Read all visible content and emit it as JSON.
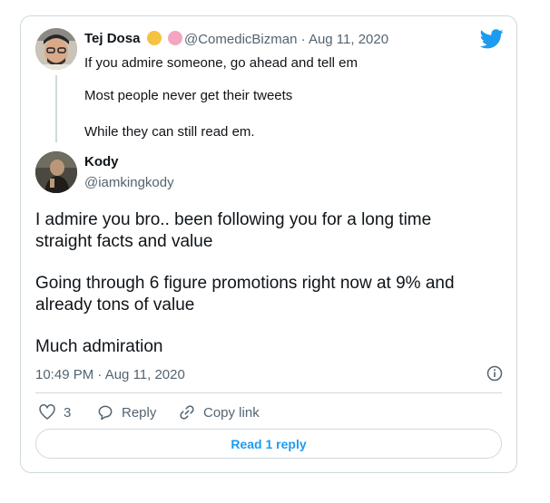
{
  "parent_tweet": {
    "author_name": "Tej Dosa",
    "emojis": [
      "laughing-tears-emoji",
      "brain-emoji"
    ],
    "handle": "@ComedicBizman",
    "separator": "·",
    "date": "Aug 11, 2020",
    "lines": [
      "If you admire someone, go ahead and tell em",
      "Most people never get their tweets",
      "While they can still read em."
    ]
  },
  "reply_tweet": {
    "author_name": "Kody",
    "handle": "@iamkingkody",
    "lines": [
      "I admire you bro.. been following you for a long time",
      "straight facts and value",
      "Going through 6 figure promotions right now at 9% and",
      "already tons of value",
      "Much admiration"
    ],
    "timestamp": "10:49 PM · Aug 11, 2020"
  },
  "actions": {
    "like_count": "3",
    "reply_label": "Reply",
    "copy_link_label": "Copy link"
  },
  "read_replies_label": "Read 1 reply",
  "colors": {
    "accent": "#1d9bf0",
    "text": "#0f1419",
    "muted": "#536471",
    "border": "#cfd9de"
  }
}
